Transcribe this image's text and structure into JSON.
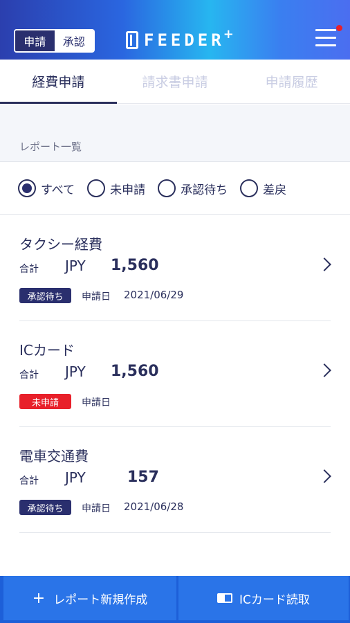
{
  "header": {
    "mode_switch": {
      "apply": "申請",
      "approve": "承認"
    },
    "logo": {
      "text": "FEEDER",
      "plus": "+"
    },
    "notification_color": "#e8202a"
  },
  "tabs": [
    {
      "label": "経費申請",
      "active": true
    },
    {
      "label": "請求書申請",
      "active": false
    },
    {
      "label": "申請履歴",
      "active": false
    }
  ],
  "section": {
    "title": "レポート一覧"
  },
  "filters": [
    {
      "label": "すべて",
      "checked": true
    },
    {
      "label": "未申請",
      "checked": false
    },
    {
      "label": "承認待ち",
      "checked": false
    },
    {
      "label": "差戻",
      "checked": false
    }
  ],
  "reports": [
    {
      "title": "タクシー経費",
      "total_label": "合計",
      "currency": "JPY",
      "amount": "1,560",
      "status": "承認待ち",
      "status_type": "pending",
      "date_label": "申請日",
      "date": "2021/06/29"
    },
    {
      "title": "ICカード",
      "total_label": "合計",
      "currency": "JPY",
      "amount": "1,560",
      "status": "未申請",
      "status_type": "unsubmitted",
      "date_label": "申請日",
      "date": ""
    },
    {
      "title": "電車交通費",
      "total_label": "合計",
      "currency": "JPY",
      "amount": "157",
      "status": "承認待ち",
      "status_type": "pending",
      "date_label": "申請日",
      "date": "2021/06/28"
    }
  ],
  "bottom": {
    "new_report_icon": "+",
    "new_report": "レポート新規作成",
    "ic_read": "ICカード読取"
  },
  "colors": {
    "primary": "#2a2f6e",
    "accent": "#2a74e8",
    "danger": "#e8202a"
  }
}
